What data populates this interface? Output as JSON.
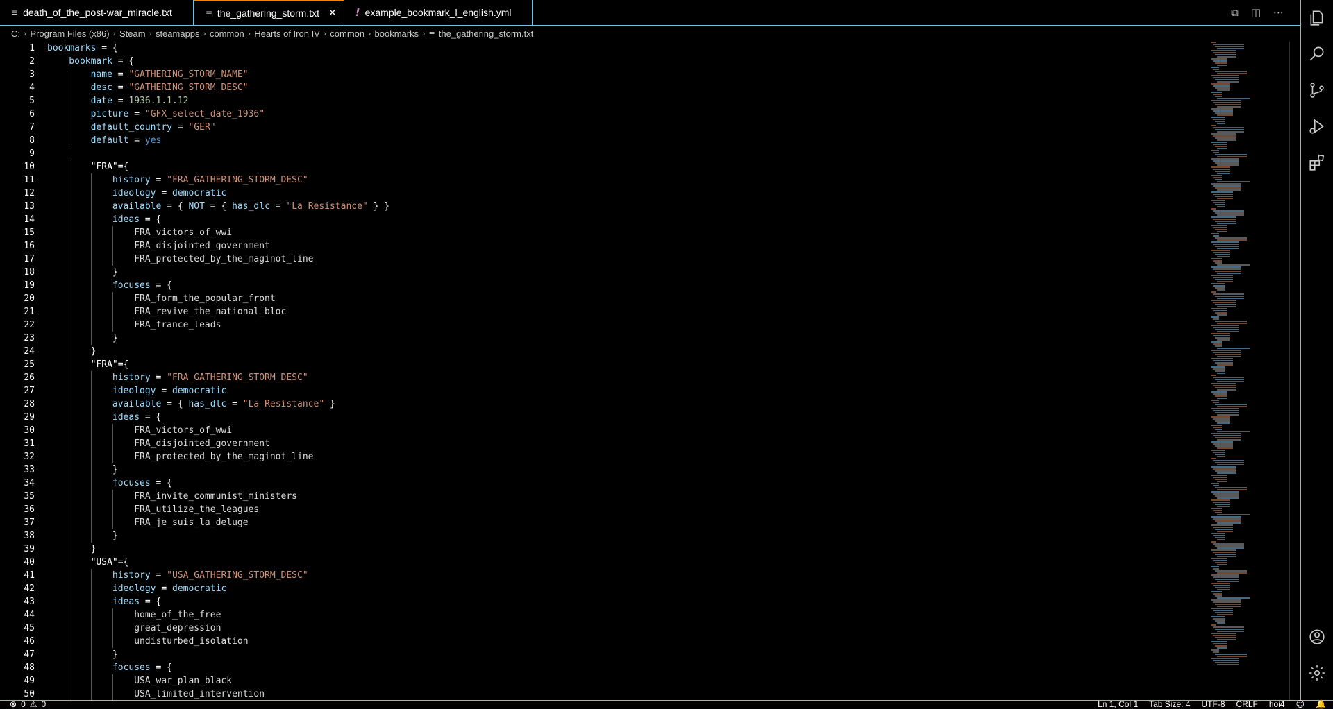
{
  "tabs": [
    {
      "label": "death_of_the_post-war_miracle.txt",
      "icon": "text-file-icon",
      "active": false
    },
    {
      "label": "the_gathering_storm.txt",
      "icon": "text-file-icon",
      "active": true
    },
    {
      "label": "example_bookmark_l_english.yml",
      "icon": "yaml-file-icon",
      "active": false
    }
  ],
  "tab_actions": [
    "open-changes-icon",
    "split-editor-icon",
    "more-actions-icon"
  ],
  "breadcrumb": [
    "C:",
    "Program Files (x86)",
    "Steam",
    "steamapps",
    "common",
    "Hearts of Iron IV",
    "common",
    "bookmarks",
    "the_gathering_storm.txt"
  ],
  "code_lines": [
    [
      0,
      [
        [
          "k",
          "bookmarks"
        ],
        [
          "w",
          " = {"
        ]
      ]
    ],
    [
      1,
      [
        [
          "k",
          "bookmark"
        ],
        [
          "w",
          " = {"
        ]
      ]
    ],
    [
      2,
      [
        [
          "k",
          "name"
        ],
        [
          "w",
          " = "
        ],
        [
          "s",
          "\"GATHERING_STORM_NAME\""
        ]
      ]
    ],
    [
      2,
      [
        [
          "k",
          "desc"
        ],
        [
          "w",
          " = "
        ],
        [
          "s",
          "\"GATHERING_STORM_DESC\""
        ]
      ]
    ],
    [
      2,
      [
        [
          "k",
          "date"
        ],
        [
          "w",
          " = "
        ],
        [
          "n",
          "1936.1.1.12"
        ]
      ]
    ],
    [
      2,
      [
        [
          "k",
          "picture"
        ],
        [
          "w",
          " = "
        ],
        [
          "s",
          "\"GFX_select_date_1936\""
        ]
      ]
    ],
    [
      2,
      [
        [
          "k",
          "default_country"
        ],
        [
          "w",
          " = "
        ],
        [
          "s",
          "\"GER\""
        ]
      ]
    ],
    [
      2,
      [
        [
          "k",
          "default"
        ],
        [
          "w",
          " = "
        ],
        [
          "v",
          "yes"
        ]
      ]
    ],
    [
      0,
      []
    ],
    [
      2,
      [
        [
          "w",
          "\"FRA\"={"
        ]
      ]
    ],
    [
      3,
      [
        [
          "k",
          "history"
        ],
        [
          "w",
          " = "
        ],
        [
          "s",
          "\"FRA_GATHERING_STORM_DESC\""
        ]
      ]
    ],
    [
      3,
      [
        [
          "k",
          "ideology"
        ],
        [
          "w",
          " = "
        ],
        [
          "k",
          "democratic"
        ]
      ]
    ],
    [
      3,
      [
        [
          "k",
          "available"
        ],
        [
          "w",
          " = { "
        ],
        [
          "k",
          "NOT"
        ],
        [
          "w",
          " = { "
        ],
        [
          "k",
          "has_dlc"
        ],
        [
          "w",
          " = "
        ],
        [
          "s",
          "\"La Resistance\""
        ],
        [
          "w",
          " } }"
        ]
      ]
    ],
    [
      3,
      [
        [
          "k",
          "ideas"
        ],
        [
          "w",
          " = {"
        ]
      ]
    ],
    [
      4,
      [
        [
          "id",
          "FRA_victors_of_wwi"
        ]
      ]
    ],
    [
      4,
      [
        [
          "id",
          "FRA_disjointed_government"
        ]
      ]
    ],
    [
      4,
      [
        [
          "id",
          "FRA_protected_by_the_maginot_line"
        ]
      ]
    ],
    [
      3,
      [
        [
          "w",
          "}"
        ]
      ]
    ],
    [
      3,
      [
        [
          "k",
          "focuses"
        ],
        [
          "w",
          " = {"
        ]
      ]
    ],
    [
      4,
      [
        [
          "id",
          "FRA_form_the_popular_front"
        ]
      ]
    ],
    [
      4,
      [
        [
          "id",
          "FRA_revive_the_national_bloc"
        ]
      ]
    ],
    [
      4,
      [
        [
          "id",
          "FRA_france_leads"
        ]
      ]
    ],
    [
      3,
      [
        [
          "w",
          "}"
        ]
      ]
    ],
    [
      2,
      [
        [
          "w",
          "}"
        ]
      ]
    ],
    [
      2,
      [
        [
          "w",
          "\"FRA\"={"
        ]
      ]
    ],
    [
      3,
      [
        [
          "k",
          "history"
        ],
        [
          "w",
          " = "
        ],
        [
          "s",
          "\"FRA_GATHERING_STORM_DESC\""
        ]
      ]
    ],
    [
      3,
      [
        [
          "k",
          "ideology"
        ],
        [
          "w",
          " = "
        ],
        [
          "k",
          "democratic"
        ]
      ]
    ],
    [
      3,
      [
        [
          "k",
          "available"
        ],
        [
          "w",
          " = { "
        ],
        [
          "k",
          "has_dlc"
        ],
        [
          "w",
          " = "
        ],
        [
          "s",
          "\"La Resistance\""
        ],
        [
          "w",
          " }"
        ]
      ]
    ],
    [
      3,
      [
        [
          "k",
          "ideas"
        ],
        [
          "w",
          " = {"
        ]
      ]
    ],
    [
      4,
      [
        [
          "id",
          "FRA_victors_of_wwi"
        ]
      ]
    ],
    [
      4,
      [
        [
          "id",
          "FRA_disjointed_government"
        ]
      ]
    ],
    [
      4,
      [
        [
          "id",
          "FRA_protected_by_the_maginot_line"
        ]
      ]
    ],
    [
      3,
      [
        [
          "w",
          "}"
        ]
      ]
    ],
    [
      3,
      [
        [
          "k",
          "focuses"
        ],
        [
          "w",
          " = {"
        ]
      ]
    ],
    [
      4,
      [
        [
          "id",
          "FRA_invite_communist_ministers"
        ]
      ]
    ],
    [
      4,
      [
        [
          "id",
          "FRA_utilize_the_leagues"
        ]
      ]
    ],
    [
      4,
      [
        [
          "id",
          "FRA_je_suis_la_deluge"
        ]
      ]
    ],
    [
      3,
      [
        [
          "w",
          "}"
        ]
      ]
    ],
    [
      2,
      [
        [
          "w",
          "}"
        ]
      ]
    ],
    [
      2,
      [
        [
          "w",
          "\"USA\"={"
        ]
      ]
    ],
    [
      3,
      [
        [
          "k",
          "history"
        ],
        [
          "w",
          " = "
        ],
        [
          "s",
          "\"USA_GATHERING_STORM_DESC\""
        ]
      ]
    ],
    [
      3,
      [
        [
          "k",
          "ideology"
        ],
        [
          "w",
          " = "
        ],
        [
          "k",
          "democratic"
        ]
      ]
    ],
    [
      3,
      [
        [
          "k",
          "ideas"
        ],
        [
          "w",
          " = {"
        ]
      ]
    ],
    [
      4,
      [
        [
          "id",
          "home_of_the_free"
        ]
      ]
    ],
    [
      4,
      [
        [
          "id",
          "great_depression"
        ]
      ]
    ],
    [
      4,
      [
        [
          "id",
          "undisturbed_isolation"
        ]
      ]
    ],
    [
      3,
      [
        [
          "w",
          "}"
        ]
      ]
    ],
    [
      3,
      [
        [
          "k",
          "focuses"
        ],
        [
          "w",
          " = {"
        ]
      ]
    ],
    [
      4,
      [
        [
          "id",
          "USA_war_plan_black"
        ]
      ]
    ],
    [
      4,
      [
        [
          "id",
          "USA_limited_intervention"
        ]
      ]
    ]
  ],
  "activity_icons": [
    "explorer-icon",
    "search-icon",
    "source-control-icon",
    "run-debug-icon",
    "extensions-icon",
    "account-icon",
    "settings-gear-icon"
  ],
  "status": {
    "errors": "0",
    "warnings": "0",
    "cursor": "Ln 1, Col 1",
    "tab_size": "Tab Size: 4",
    "encoding": "UTF-8",
    "eol": "CRLF",
    "language": "hoi4"
  },
  "colors": {
    "border": "#6fc3df",
    "active_tab": "#f38518",
    "keyword": "#9cdcfe",
    "string": "#ce9178",
    "number": "#b5cea8",
    "value": "#569cd6"
  }
}
